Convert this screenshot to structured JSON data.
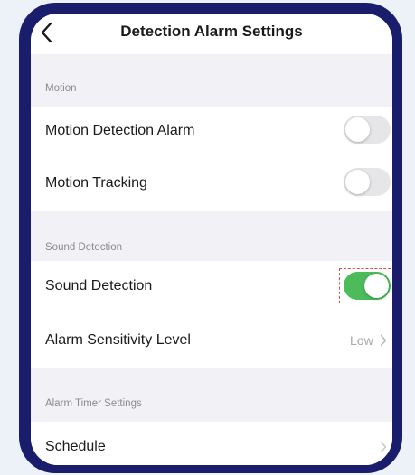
{
  "header": {
    "title": "Detection Alarm Settings",
    "back_icon": "chevron-left-icon"
  },
  "sections": {
    "motion": {
      "header": "Motion",
      "rows": [
        {
          "label": "Motion Detection Alarm",
          "toggle": "off"
        },
        {
          "label": "Motion Tracking",
          "toggle": "off"
        }
      ]
    },
    "sound": {
      "header": "Sound Detection",
      "rows": [
        {
          "label": "Sound Detection",
          "toggle": "on"
        },
        {
          "label": "Alarm Sensitivity Level",
          "value": "Low",
          "icon": "chevron-right-icon"
        }
      ]
    },
    "timer": {
      "header": "Alarm Timer Settings",
      "rows": [
        {
          "label": "Schedule",
          "icon": "chevron-right-icon"
        }
      ]
    }
  },
  "colors": {
    "frame": "#1a1d6b",
    "background": "#f2f2f6",
    "toggle_on": "#4cbb5a",
    "toggle_off": "#e6e6e9",
    "highlight": "#e2473b"
  }
}
